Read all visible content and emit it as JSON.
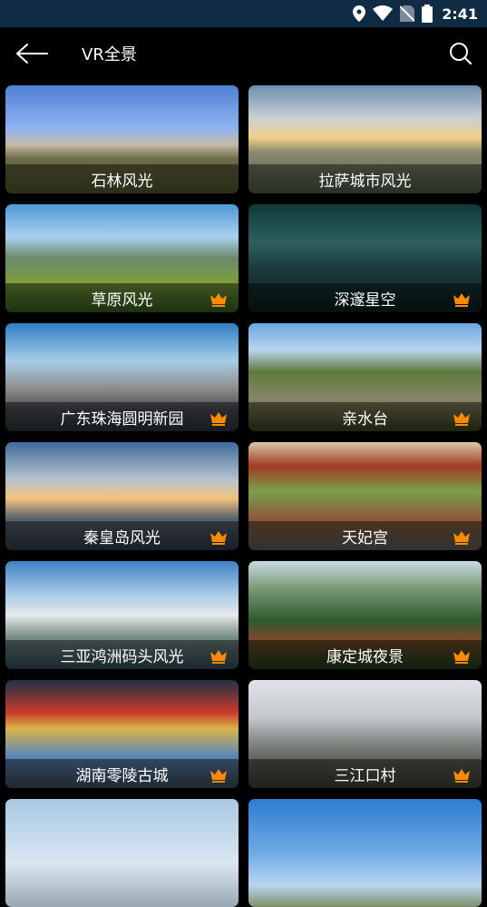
{
  "status_bar": {
    "time": "2:41",
    "icons": [
      "location-icon",
      "wifi-icon",
      "no-sim-icon",
      "battery-icon"
    ]
  },
  "app_bar": {
    "title": "VR全景",
    "back_icon": "back-arrow-icon",
    "search_icon": "search-icon"
  },
  "colors": {
    "status_bar_bg": "#0f2c44",
    "background": "#000000",
    "crown": "#ff8a00"
  },
  "cards": [
    {
      "label": "石林风光",
      "premium": false
    },
    {
      "label": "拉萨城市风光",
      "premium": false
    },
    {
      "label": "草原风光",
      "premium": true
    },
    {
      "label": "深邃星空",
      "premium": true
    },
    {
      "label": "广东珠海圆明新园",
      "premium": true
    },
    {
      "label": "亲水台",
      "premium": true
    },
    {
      "label": "秦皇岛风光",
      "premium": true
    },
    {
      "label": "天妃宫",
      "premium": true
    },
    {
      "label": "三亚鸿洲码头风光",
      "premium": true
    },
    {
      "label": "康定城夜景",
      "premium": true
    },
    {
      "label": "湖南零陵古城",
      "premium": true
    },
    {
      "label": "三江口村",
      "premium": true
    },
    {
      "label": "",
      "premium": false
    },
    {
      "label": "",
      "premium": false
    }
  ]
}
